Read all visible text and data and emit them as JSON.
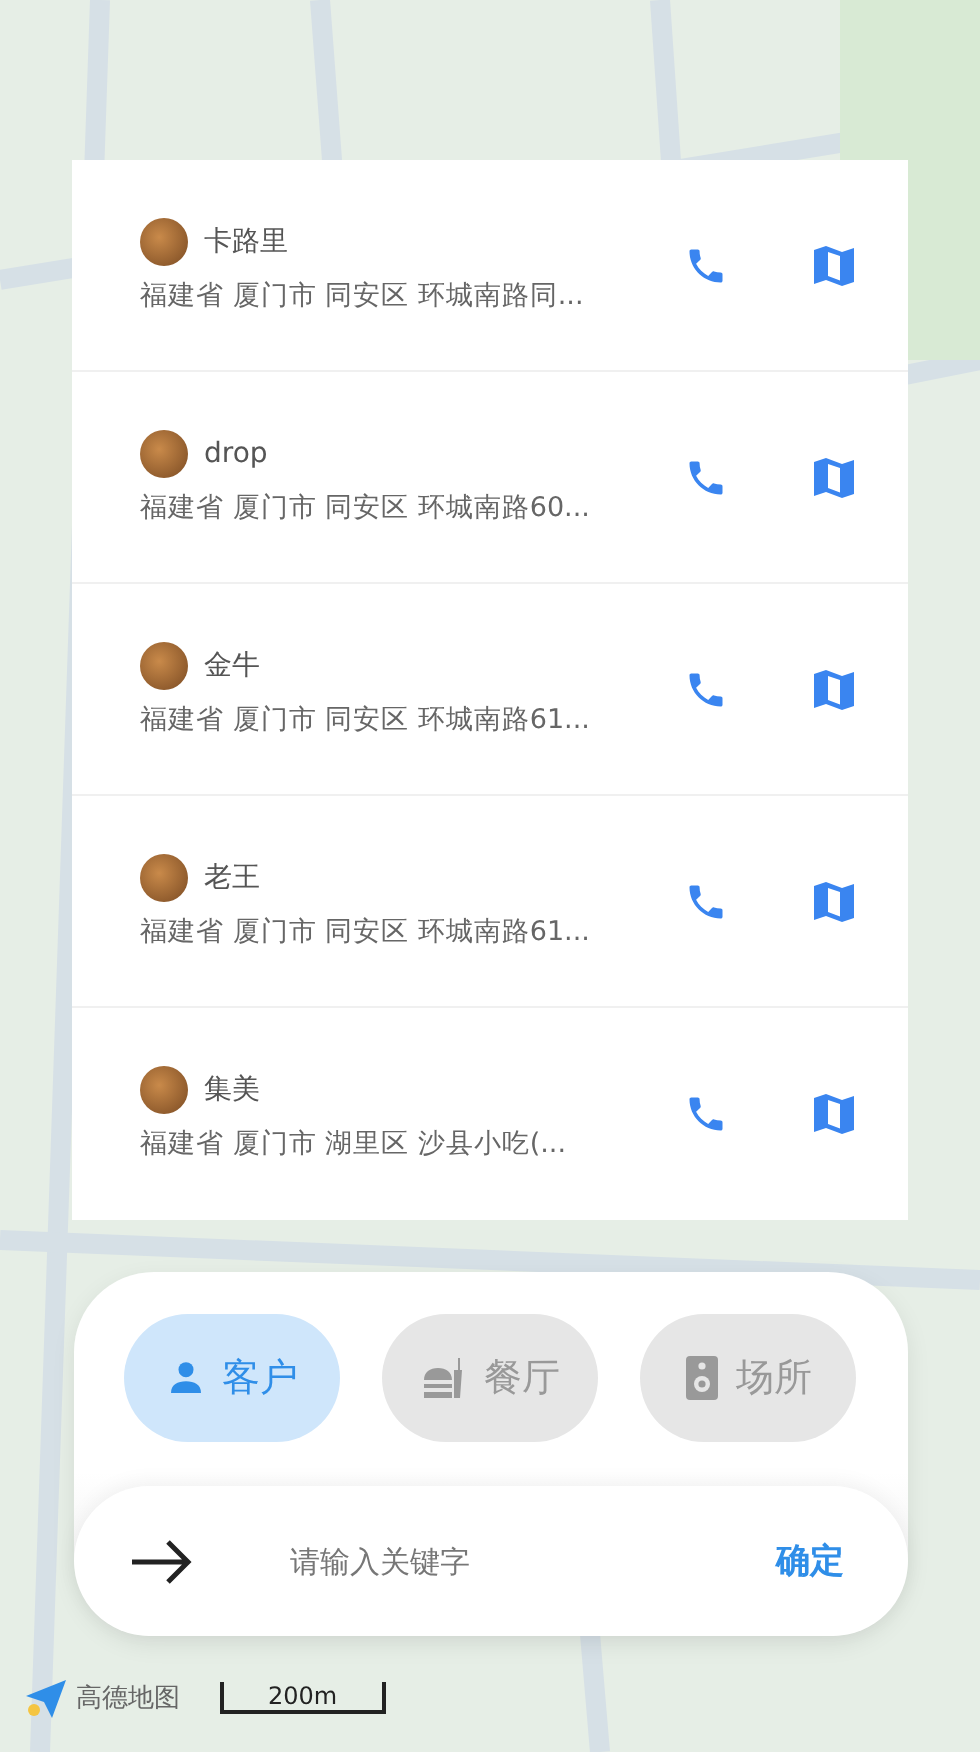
{
  "contacts": [
    {
      "name": "卡路里",
      "address": "福建省 厦门市 同安区 环城南路同..."
    },
    {
      "name": "drop",
      "address": "福建省 厦门市 同安区 环城南路60..."
    },
    {
      "name": "金牛",
      "address": "福建省 厦门市 同安区 环城南路61..."
    },
    {
      "name": "老王",
      "address": "福建省 厦门市 同安区 环城南路61..."
    },
    {
      "name": "集美",
      "address": "福建省 厦门市 湖里区  沙县小吃(..."
    }
  ],
  "categories": [
    {
      "kind": "person",
      "label": "客户",
      "selected": true
    },
    {
      "kind": "restaurant",
      "label": "餐厅",
      "selected": false
    },
    {
      "kind": "venue",
      "label": "场所",
      "selected": false
    }
  ],
  "search": {
    "placeholder": "请输入关键字",
    "confirm": "确定"
  },
  "map_footer": {
    "logo_text": "高德地图",
    "scale": "200m"
  }
}
